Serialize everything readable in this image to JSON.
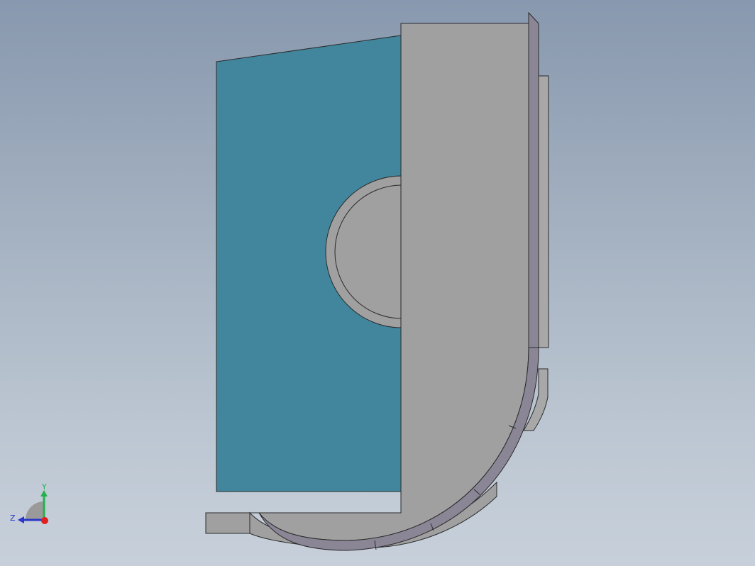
{
  "viewport": {
    "background_top": "#8898ae",
    "background_bottom": "#c7d0da"
  },
  "model": {
    "colors": {
      "teal_face": "#41869c",
      "gray_body": "#a0a0a0",
      "dark_edge": "#8a8696",
      "outline": "#2a2a2a"
    }
  },
  "triad": {
    "y_label": "Y",
    "z_label": "Z",
    "y_color": "#22b14c",
    "z_color": "#2a36c8",
    "x_color": "#e0201c"
  }
}
